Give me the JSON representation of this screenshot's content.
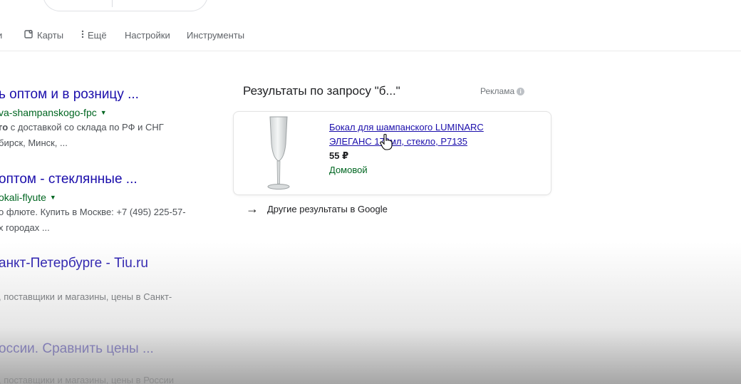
{
  "tabs": {
    "cut_label": "и",
    "maps_label": "Карты",
    "more_label": "Ещё",
    "settings_label": "Настройки",
    "tools_label": "Инструменты"
  },
  "results": [
    {
      "title": "ь оптом и в розницу ...",
      "url": "va-shampanskogo-fpc",
      "snippet_bold": "го",
      "snippet_line1": " с доставкой со склада по РФ и СНГ",
      "snippet_line2": "бирск, Минск, ..."
    },
    {
      "title": "оптом - стеклянные ...",
      "url": "okali-flyute",
      "snippet_line1": "о флюте. Купить в Москве: +7 (495) 225-57-",
      "snippet_line2": "х городах ..."
    },
    {
      "title": "анкт-Петербурге - Tiu.ru",
      "snippet_line1": ", поставщики и магазины, цены в Санкт-"
    },
    {
      "title": "оссии. Сравнить цены ...",
      "snippet_line1": ", поставщики и магазины, цены в России"
    }
  ],
  "ads": {
    "heading": "Результаты по запросу \"б...\"",
    "label": "Реклама",
    "info_icon": "i",
    "product": {
      "title": "Бокал для шампанского LUMINARC ЭЛЕГАНС 170мл, стекло, P7135",
      "price": "55 ₽",
      "seller": "Домовой",
      "image_icon": "champagne-glass"
    },
    "more_link": "Другие результаты в Google",
    "more_arrow": "→"
  },
  "colors": {
    "link": "#1a0dab",
    "url": "#006621",
    "snippet": "#4d5156",
    "muted": "#70757a"
  }
}
